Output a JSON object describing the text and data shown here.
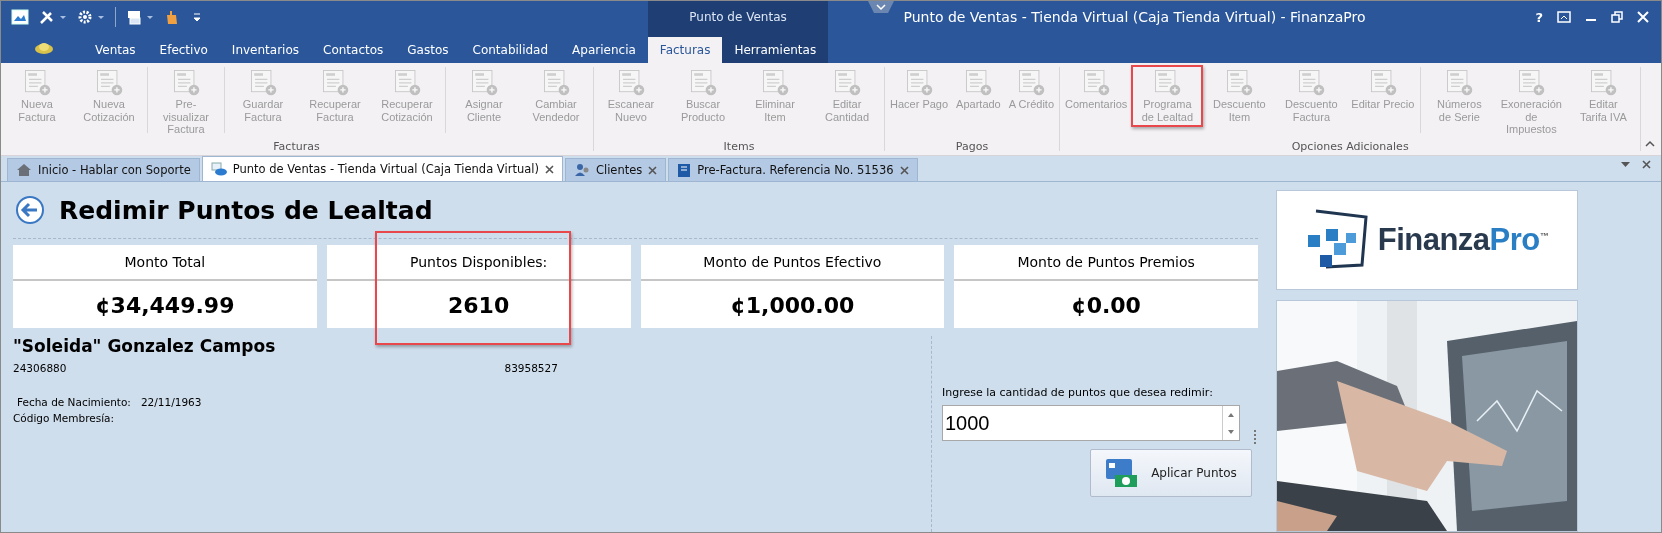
{
  "window": {
    "title": "Punto de Ventas - Tienda Virtual (Caja Tienda Virtual) - FinanzaPro",
    "help": "?"
  },
  "context_tab_group": {
    "label": "Punto de Ventas"
  },
  "menu_tabs": [
    {
      "label": "Ventas",
      "selected": false,
      "context": false
    },
    {
      "label": "Efectivo",
      "selected": false,
      "context": false
    },
    {
      "label": "Inventarios",
      "selected": false,
      "context": false
    },
    {
      "label": "Contactos",
      "selected": false,
      "context": false
    },
    {
      "label": "Gastos",
      "selected": false,
      "context": false
    },
    {
      "label": "Contabilidad",
      "selected": false,
      "context": false
    },
    {
      "label": "Apariencia",
      "selected": false,
      "context": false
    },
    {
      "label": "Facturas",
      "selected": true,
      "context": true
    },
    {
      "label": "Herramientas",
      "selected": false,
      "context": true
    }
  ],
  "ribbon_groups": [
    {
      "label": "Facturas",
      "sections": [
        [
          {
            "label": "Nueva Factura",
            "disabled": true,
            "highlighted": false
          },
          {
            "label": "Nueva Cotización",
            "disabled": true,
            "highlighted": false
          }
        ],
        [
          {
            "label": "Pre-visualizar Factura",
            "disabled": true,
            "highlighted": false
          }
        ],
        [
          {
            "label": "Guardar Factura",
            "disabled": true,
            "highlighted": false
          },
          {
            "label": "Recuperar Factura",
            "disabled": true,
            "highlighted": false
          },
          {
            "label": "Recuperar Cotización",
            "disabled": true,
            "highlighted": false
          }
        ],
        [
          {
            "label": "Asignar Cliente",
            "disabled": true,
            "highlighted": false
          },
          {
            "label": "Cambiar Vendedor",
            "disabled": true,
            "highlighted": false
          }
        ]
      ]
    },
    {
      "label": "Items",
      "sections": [
        [
          {
            "label": "Escanear Nuevo",
            "disabled": true,
            "highlighted": false
          },
          {
            "label": "Buscar Producto",
            "disabled": true,
            "highlighted": false
          },
          {
            "label": "Eliminar Item",
            "disabled": true,
            "highlighted": false
          },
          {
            "label": "Editar Cantidad",
            "disabled": true,
            "highlighted": false
          }
        ]
      ]
    },
    {
      "label": "Pagos",
      "sections": [
        [
          {
            "label": "Hacer Pago",
            "disabled": true,
            "highlighted": false
          },
          {
            "label": "Apartado",
            "disabled": true,
            "highlighted": false
          },
          {
            "label": "A Crédito",
            "disabled": true,
            "highlighted": false
          }
        ]
      ]
    },
    {
      "label": "Opciones Adicionales",
      "sections": [
        [
          {
            "label": "Comentarios",
            "disabled": true,
            "highlighted": false
          },
          {
            "label": "Programa de Lealtad",
            "disabled": true,
            "highlighted": true
          },
          {
            "label": "Descuento Item",
            "disabled": true,
            "highlighted": false
          },
          {
            "label": "Descuento Factura",
            "disabled": true,
            "highlighted": false
          },
          {
            "label": "Editar Precio",
            "disabled": true,
            "highlighted": false
          }
        ],
        [
          {
            "label": "Números de Serie",
            "disabled": true,
            "highlighted": false
          },
          {
            "label": "Exoneración de Impuestos",
            "disabled": true,
            "highlighted": false
          },
          {
            "label": "Editar Tarifa IVA",
            "disabled": true,
            "highlighted": false
          }
        ]
      ]
    }
  ],
  "document_tabs": [
    {
      "label": "Inicio - Hablar con Soporte",
      "selected": false,
      "closable": false
    },
    {
      "label": "Punto de Ventas - Tienda Virtual (Caja Tienda Virtual)",
      "selected": true,
      "closable": true
    },
    {
      "label": "Clientes",
      "selected": false,
      "closable": true
    },
    {
      "label": "Pre-Factura. Referencia No. 51536",
      "selected": false,
      "closable": true
    }
  ],
  "page": {
    "title": "Redimir Puntos de Lealtad",
    "cards": [
      {
        "label": "Monto Total",
        "value": "¢34,449.99",
        "highlighted": false
      },
      {
        "label": "Puntos Disponibles:",
        "value": "2610",
        "highlighted": true
      },
      {
        "label": "Monto de Puntos Efectivo",
        "value": "¢1,000.00",
        "highlighted": false
      },
      {
        "label": "Monto de Puntos Premios",
        "value": "¢0.00",
        "highlighted": false
      }
    ],
    "customer": {
      "name": "\"Soleida\" Gonzalez Campos",
      "id": "24306880",
      "phone": "83958527",
      "birth_label": "Fecha de Nacimiento:",
      "birth_date": "22/11/1963",
      "membership_label": "Código Membresía:"
    },
    "redeem": {
      "label": "Ingrese la cantidad de puntos que desea redimir:",
      "value": "1000",
      "button": "Aplicar Puntos"
    }
  },
  "logo": {
    "parts": [
      "Finanza",
      "Pro"
    ],
    "mark": "™"
  }
}
